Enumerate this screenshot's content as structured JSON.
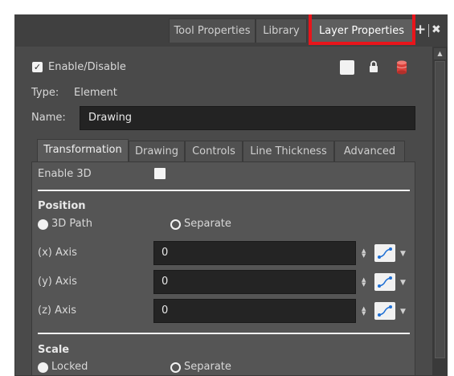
{
  "tabs": [
    {
      "label": "Tool Properties",
      "active": false
    },
    {
      "label": "Library",
      "active": false
    },
    {
      "label": "Layer Properties",
      "active": true
    }
  ],
  "tabbar": {
    "add_glyph": "+",
    "close_glyph": "✖"
  },
  "enable_label": "Enable/Disable",
  "type": {
    "label": "Type:",
    "value": "Element"
  },
  "name": {
    "label": "Name:",
    "value": "Drawing"
  },
  "inner_tabs": [
    {
      "label": "Transformation",
      "active": true
    },
    {
      "label": "Drawing",
      "active": false
    },
    {
      "label": "Controls",
      "active": false
    },
    {
      "label": "Line Thickness",
      "active": false
    },
    {
      "label": "Advanced",
      "active": false
    }
  ],
  "enable_3d_label": "Enable 3D",
  "position": {
    "heading": "Position",
    "option_3d_path": "3D Path",
    "option_separate": "Separate",
    "axes": [
      {
        "label": "(x) Axis",
        "value": "0"
      },
      {
        "label": "(y) Axis",
        "value": "0"
      },
      {
        "label": "(z) Axis",
        "value": "0"
      }
    ]
  },
  "scale": {
    "heading": "Scale",
    "option_locked": "Locked",
    "option_separate": "Separate"
  },
  "icons": {
    "checkbox_tick": "✓",
    "stepper_up": "▲",
    "stepper_down": "▼",
    "dropdown": "▼",
    "scroll_up": "▲"
  },
  "colors": {
    "highlight": "#e8151b",
    "cylinder": "#d9403a",
    "function_curve": "#1e6fd4"
  }
}
